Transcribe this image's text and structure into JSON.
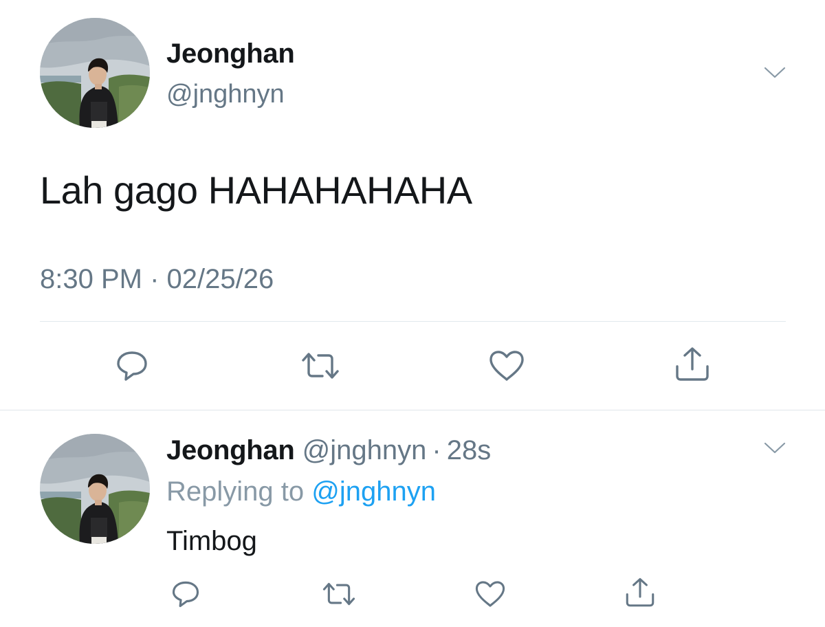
{
  "colors": {
    "text_primary": "#14171a",
    "text_secondary": "#657786",
    "link": "#1da1f2",
    "divider": "#e1e8ed"
  },
  "tweet": {
    "author_name": "Jeonghan",
    "author_handle": "@jnghnyn",
    "text": "Lah gago HAHAHAHAHA",
    "timestamp": "8:30 PM · 02/25/26",
    "menu_icon": "chevron-down-icon",
    "actions": {
      "reply_icon": "reply-icon",
      "retweet_icon": "retweet-icon",
      "like_icon": "heart-icon",
      "share_icon": "share-icon"
    }
  },
  "reply": {
    "author_name": "Jeonghan",
    "author_handle": "@jnghnyn",
    "separator": "·",
    "time_ago": "28s",
    "replying_prefix": "Replying to",
    "replying_to_handle": "@jnghnyn",
    "text": "Timbog",
    "menu_icon": "chevron-down-icon",
    "actions": {
      "reply_icon": "reply-icon",
      "retweet_icon": "retweet-icon",
      "like_icon": "heart-icon",
      "share_icon": "share-icon"
    }
  }
}
